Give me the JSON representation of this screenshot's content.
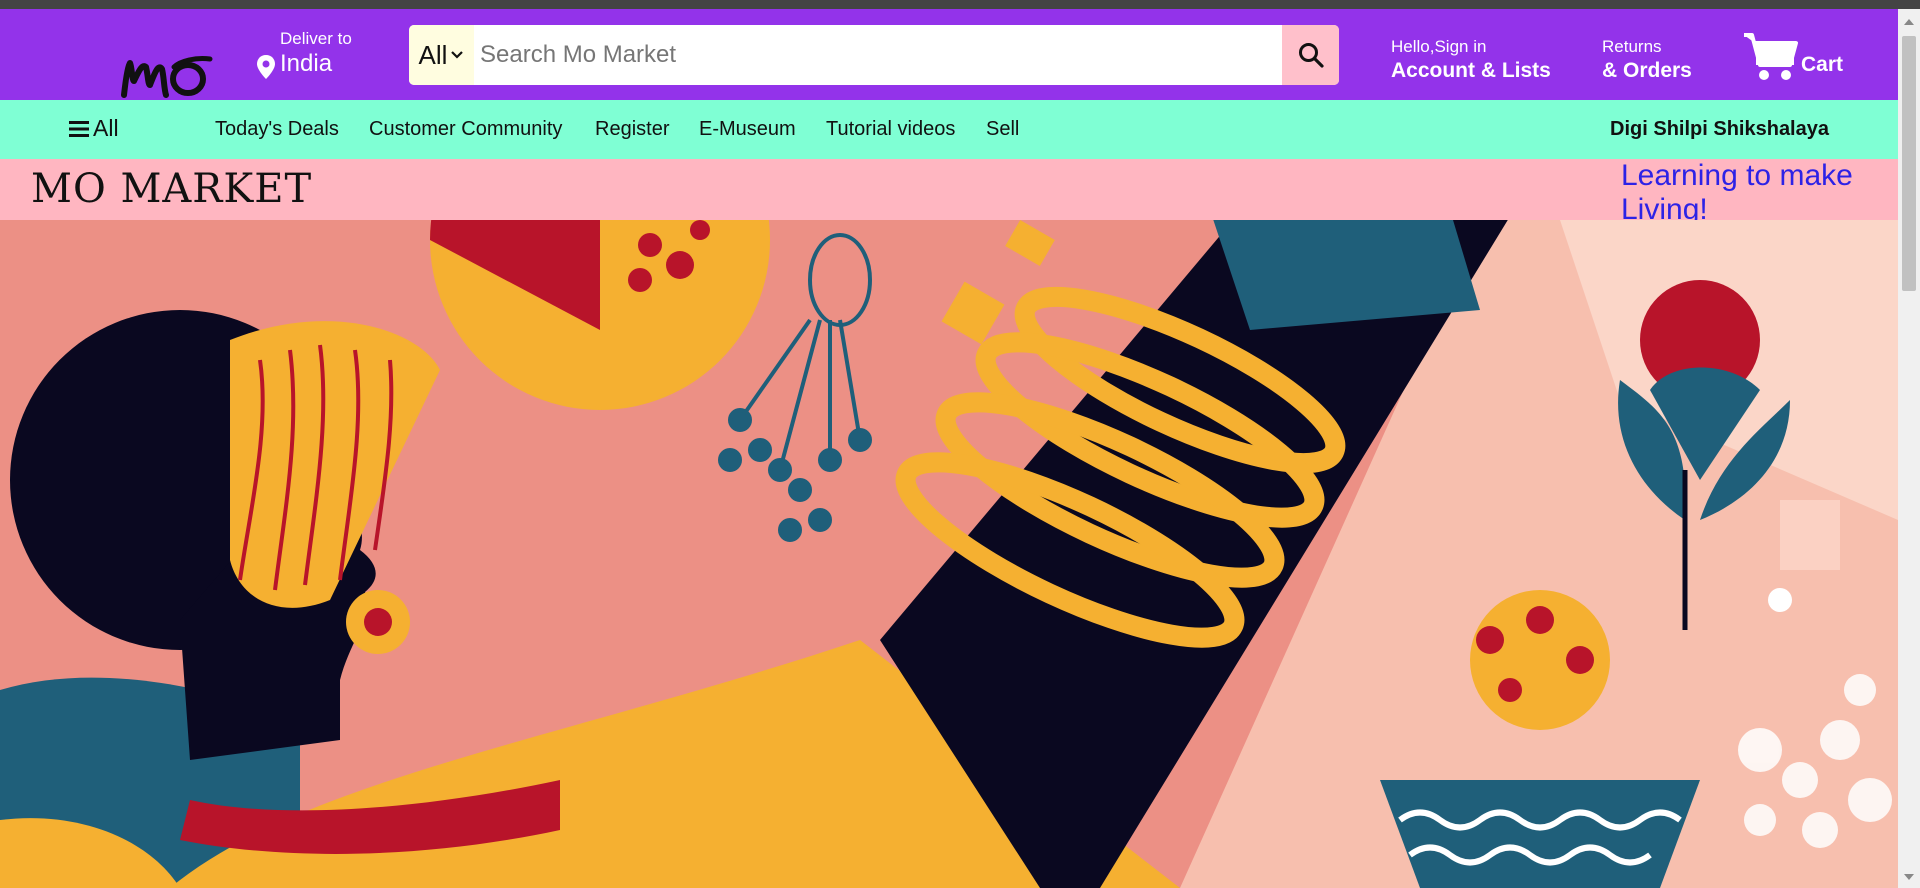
{
  "header": {
    "logo_text": "mo",
    "deliver_label": "Deliver to",
    "deliver_location": "India",
    "search": {
      "category": "All",
      "placeholder": "Search Mo Market"
    },
    "account": {
      "greeting": "Hello,Sign in",
      "label": "Account & Lists"
    },
    "orders": {
      "line1": "Returns",
      "line2": "& Orders"
    },
    "cart_label": "Cart"
  },
  "subnav": {
    "all_label": "All",
    "items": [
      "Today's Deals",
      "Customer Community",
      "Register",
      "E-Museum",
      "Tutorial videos",
      "Sell"
    ],
    "right_link": "Digi Shilpi Shikshalaya"
  },
  "banner": {
    "title": "MO MARKET",
    "tagline": "Learning to make Living!"
  },
  "hero": {
    "image": "illustrated-artisan-woman-with-bangles"
  },
  "colors": {
    "navbar": "#9333ea",
    "subnav": "#7fffd4",
    "banner": "#ffb6c1",
    "search_button": "#ffc0cb",
    "tagline": "#2d22e6"
  }
}
